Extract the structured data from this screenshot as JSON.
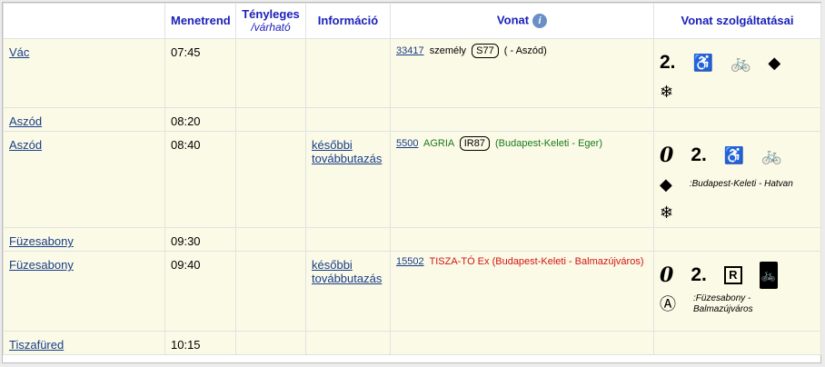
{
  "headers": {
    "menetrend": "Menetrend",
    "tenyleges": "Tényleges",
    "varhato": "/várható",
    "informacio": "Információ",
    "vonat": "Vonat",
    "szolgaltatasai": "Vonat szolgáltatásai"
  },
  "rows": [
    {
      "station": "Vác",
      "time": "07:45",
      "info": "",
      "train": {
        "number": "33417",
        "kind": "személy",
        "badge": "S77",
        "route": "( - Aszód)",
        "color": "#000000"
      },
      "services": {
        "zero": false,
        "class": "2.",
        "icons": [
          "wheelchair-icon",
          "bicycle-icon",
          "diamond-icon",
          "snowflake-icon"
        ],
        "note": ""
      }
    },
    {
      "station": "Aszód",
      "time": "08:20",
      "info": ""
    },
    {
      "station": "Aszód",
      "time": "08:40",
      "info": "későbbi továbbutazás",
      "train": {
        "number": "5500",
        "kind": "AGRIA",
        "badge": "IR87",
        "route": "(Budapest-Keleti - Eger)",
        "color": "#1b7a1b"
      },
      "services": {
        "zero": true,
        "class": "2.",
        "icons": [
          "wheelchair-icon",
          "bicycle-icon",
          "diamond-icon",
          "snowflake-icon"
        ],
        "note": ":Budapest-Keleti - Hatvan"
      }
    },
    {
      "station": "Füzesabony",
      "time": "09:30",
      "info": ""
    },
    {
      "station": "Füzesabony",
      "time": "09:40",
      "info": "későbbi továbbutazás",
      "train": {
        "number": "15502",
        "kind": "TISZA-TÓ Ex",
        "badge": "",
        "route": "(Budapest-Keleti - Balmazújváros)",
        "color": "#d41414"
      },
      "services": {
        "zero": true,
        "class": "2.",
        "icons": [
          "reservation-icon",
          "bicycle-box-icon",
          "a-circle-icon"
        ],
        "note": ":Füzesabony - Balmazújváros"
      }
    },
    {
      "station": "Tiszafüred",
      "time": "10:15",
      "info": ""
    }
  ],
  "symbols": {
    "zero": "0",
    "wheelchair": "♿",
    "bicycle": "🚲",
    "diamond": "◆",
    "snowflake": "❄",
    "reservation": "R",
    "a_circle": "Ⓐ",
    "info": "i"
  }
}
